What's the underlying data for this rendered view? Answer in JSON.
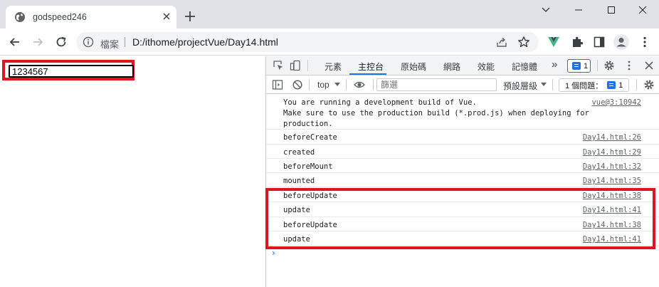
{
  "browser": {
    "tab_title": "godspeed246",
    "address_scheme": "檔案",
    "address_url": "D:/ithome/projectVue/Day14.html"
  },
  "page": {
    "input_value": "1234567"
  },
  "devtools": {
    "tabs": [
      "元素",
      "主控台",
      "原始碼",
      "網路",
      "效能",
      "記憶體"
    ],
    "more_tabs": "»",
    "messages_badge": "1",
    "context_select": "top",
    "filter_placeholder": "篩選",
    "levels_select": "預設層級",
    "issues_label": "1 個問題：",
    "issues_badge": "1",
    "console_messages": [
      {
        "text": "You are running a development build of Vue.\nMake sure to use the production build (*.prod.js) when deploying for\nproduction.",
        "source": "vue@3:10942"
      },
      {
        "text": "beforeCreate",
        "source": "Day14.html:26"
      },
      {
        "text": "created",
        "source": "Day14.html:29"
      },
      {
        "text": "beforeMount",
        "source": "Day14.html:32"
      },
      {
        "text": "mounted",
        "source": "Day14.html:35"
      },
      {
        "text": "beforeUpdate",
        "source": "Day14.html:38"
      },
      {
        "text": "update",
        "source": "Day14.html:41"
      },
      {
        "text": "beforeUpdate",
        "source": "Day14.html:38"
      },
      {
        "text": "update",
        "source": "Day14.html:41"
      }
    ],
    "prompt": "›"
  },
  "colors": {
    "highlight": "#e0161f",
    "accent": "#1a73e8"
  }
}
